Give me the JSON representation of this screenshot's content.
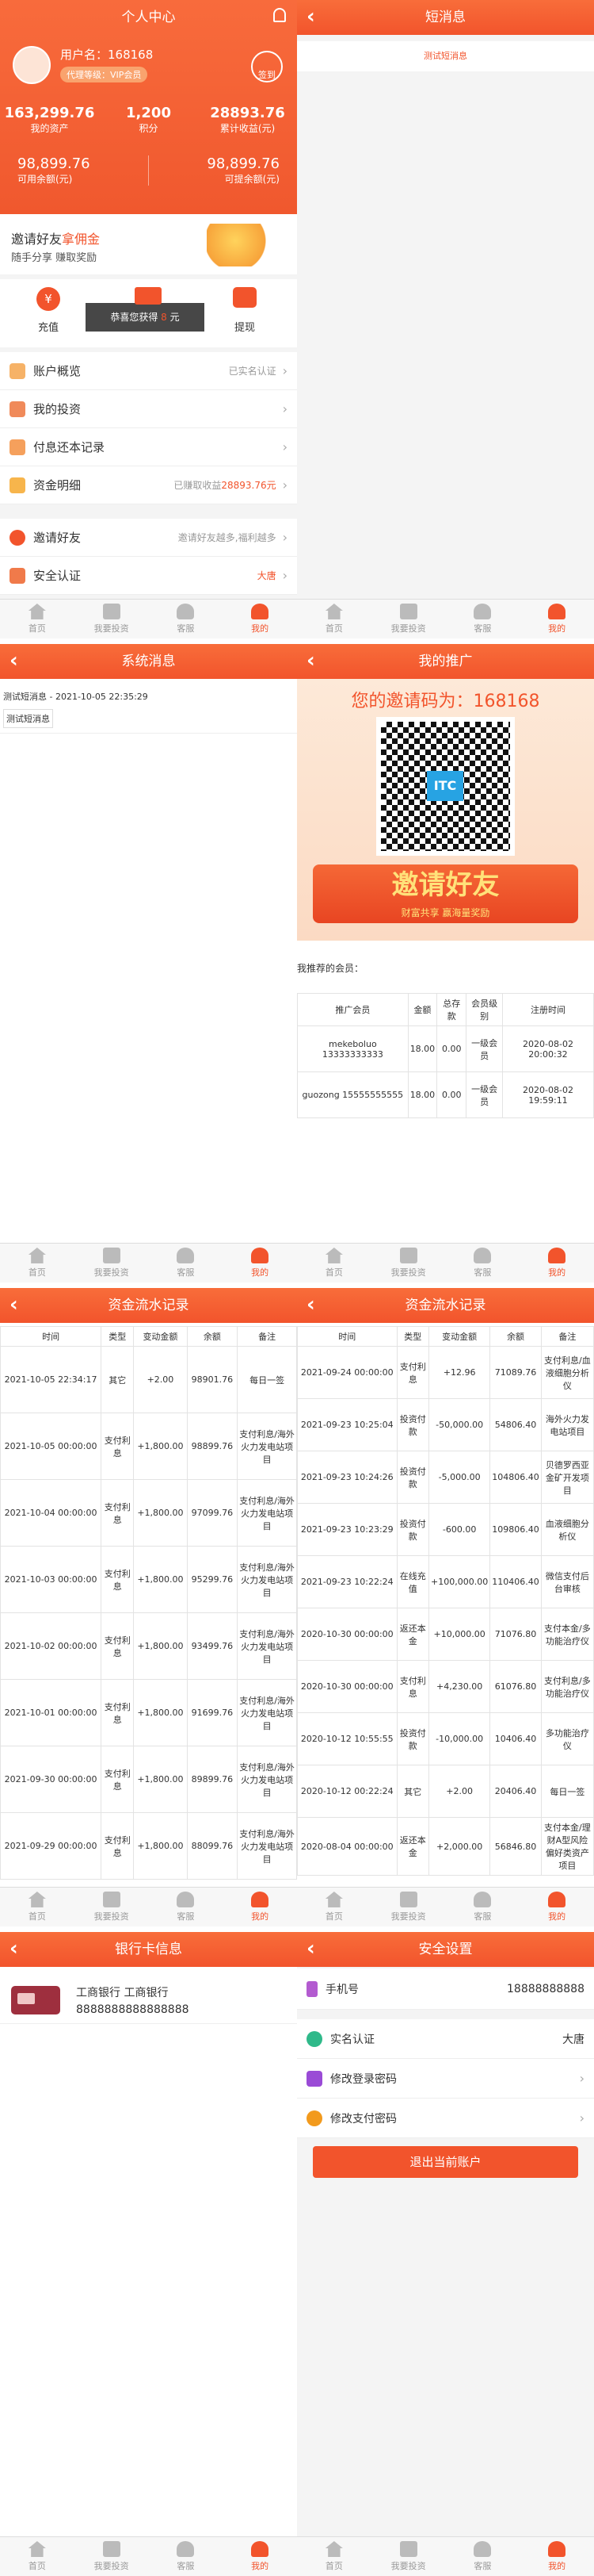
{
  "nav": {
    "home": "首页",
    "invest": "我要投资",
    "service": "客服",
    "mine": "我的"
  },
  "p1": {
    "title": "个人中心",
    "username": "用户名：168168",
    "level": "代理等级：VIP会员",
    "checkin": "签到",
    "assets": [
      {
        "value": "163,299.76",
        "label": "我的资产"
      },
      {
        "value": "1,200",
        "label": "积分"
      },
      {
        "value": "28893.76",
        "label": "累计收益(元)"
      }
    ],
    "balances": [
      {
        "value": "98,899.76",
        "label": "可用余额(元)"
      },
      {
        "value": "98,899.76",
        "label": "可提余额(元)"
      }
    ],
    "invite_a": "邀请好友",
    "invite_b": "拿佣金",
    "invite_sub": "随手分享 赚取奖励",
    "recharge": "充值",
    "withdraw": "提现",
    "toast_a": "恭喜您获得",
    "toast_b": "元",
    "rows": [
      {
        "label": "账户概览",
        "right": "已实名认证"
      },
      {
        "label": "我的投资",
        "right": ""
      },
      {
        "label": "付息还本记录",
        "right": ""
      },
      {
        "label": "资金明细",
        "right": "已赚取收益",
        "right2": "28893.76元"
      }
    ],
    "rows2": [
      {
        "label": "邀请好友",
        "right": "邀请好友越多,福利越多"
      },
      {
        "label": "安全认证",
        "right": "大唐"
      }
    ]
  },
  "p2": {
    "title": "短消息",
    "msg": "测试短消息"
  },
  "p3": {
    "title": "系统消息",
    "item": "测试短消息 - 2021-10-05 22:35:29",
    "body": "测试短消息"
  },
  "p4": {
    "title": "我的推广",
    "code": "您的邀请码为：168168",
    "qr_mark": "ITC",
    "invite": "邀请好友",
    "invite_sub": "财富共享 赢海量奖励",
    "members": "我推荐的会员：",
    "headers": [
      "推广会员",
      "金额",
      "总存款",
      "会员级别",
      "注册时间"
    ],
    "rows": [
      [
        "mekeboluo 13333333333",
        "18.00",
        "0.00",
        "一级会员",
        "2020-08-02 20:00:32"
      ],
      [
        "guozong 15555555555",
        "18.00",
        "0.00",
        "一级会员",
        "2020-08-02 19:59:11"
      ]
    ]
  },
  "p5": {
    "title": "资金流水记录",
    "headers": [
      "时间",
      "类型",
      "变动金额",
      "余额",
      "备注"
    ],
    "rows": [
      [
        "2021-10-05 22:34:17",
        "其它",
        "+2.00",
        "98901.76",
        "每日一签"
      ],
      [
        "2021-10-05 00:00:00",
        "支付利息",
        "+1,800.00",
        "98899.76",
        "支付利息/海外火力发电站项目"
      ],
      [
        "2021-10-04 00:00:00",
        "支付利息",
        "+1,800.00",
        "97099.76",
        "支付利息/海外火力发电站项目"
      ],
      [
        "2021-10-03 00:00:00",
        "支付利息",
        "+1,800.00",
        "95299.76",
        "支付利息/海外火力发电站项目"
      ],
      [
        "2021-10-02 00:00:00",
        "支付利息",
        "+1,800.00",
        "93499.76",
        "支付利息/海外火力发电站项目"
      ],
      [
        "2021-10-01 00:00:00",
        "支付利息",
        "+1,800.00",
        "91699.76",
        "支付利息/海外火力发电站项目"
      ],
      [
        "2021-09-30 00:00:00",
        "支付利息",
        "+1,800.00",
        "89899.76",
        "支付利息/海外火力发电站项目"
      ],
      [
        "2021-09-29 00:00:00",
        "支付利息",
        "+1,800.00",
        "88099.76",
        "支付利息/海外火力发电站项目"
      ]
    ]
  },
  "p6": {
    "title": "资金流水记录",
    "headers": [
      "时间",
      "类型",
      "变动金额",
      "余额",
      "备注"
    ],
    "rows": [
      [
        "2021-09-24 00:00:00",
        "支付利息",
        "+12.96",
        "71089.76",
        "支付利息/血液细胞分析仪"
      ],
      [
        "2021-09-23 10:25:04",
        "投资付款",
        "-50,000.00",
        "54806.40",
        "海外火力发电站项目"
      ],
      [
        "2021-09-23 10:24:26",
        "投资付款",
        "-5,000.00",
        "104806.40",
        "贝德罗西亚金矿开发项目"
      ],
      [
        "2021-09-23 10:23:29",
        "投资付款",
        "-600.00",
        "109806.40",
        "血液细胞分析仪"
      ],
      [
        "2021-09-23 10:22:24",
        "在线充值",
        "+100,000.00",
        "110406.40",
        "微信支付后台审核"
      ],
      [
        "2020-10-30 00:00:00",
        "返还本金",
        "+10,000.00",
        "71076.80",
        "支付本金/多功能治疗仪"
      ],
      [
        "2020-10-30 00:00:00",
        "支付利息",
        "+4,230.00",
        "61076.80",
        "支付利息/多功能治疗仪"
      ],
      [
        "2020-10-12 10:55:55",
        "投资付款",
        "-10,000.00",
        "10406.40",
        "多功能治疗仪"
      ],
      [
        "2020-10-12 00:22:24",
        "其它",
        "+2.00",
        "20406.40",
        "每日一签"
      ],
      [
        "2020-08-04 00:00:00",
        "返还本金",
        "+2,000.00",
        "56846.80",
        "支付本金/理财A型风险偏好类资产项目"
      ]
    ]
  },
  "p7": {
    "title": "银行卡信息",
    "bank": "工商银行 工商银行",
    "card": "8888888888888888"
  },
  "p8": {
    "title": "安全设置",
    "phone_label": "手机号",
    "phone": "18888888888",
    "real_label": "实名认证",
    "real": "大唐",
    "login_pw": "修改登录密码",
    "pay_pw": "修改支付密码",
    "logout": "退出当前账户"
  }
}
